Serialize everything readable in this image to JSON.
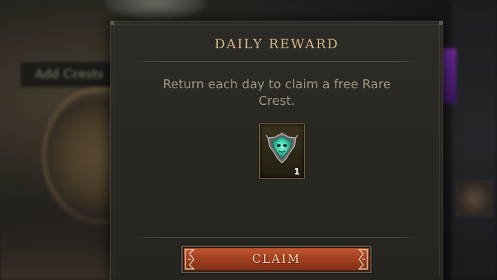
{
  "background": {
    "left_button_label": "Add Crests"
  },
  "modal": {
    "title": "DAILY REWARD",
    "description": "Return each day to claim a free Rare Crest.",
    "reward": {
      "icon": "rare-crest-icon",
      "count": "1"
    },
    "claim_label": "CLAIM"
  },
  "colors": {
    "title": "#d4b98a",
    "button": "#b04a25",
    "crest": "#3fd6b0"
  }
}
